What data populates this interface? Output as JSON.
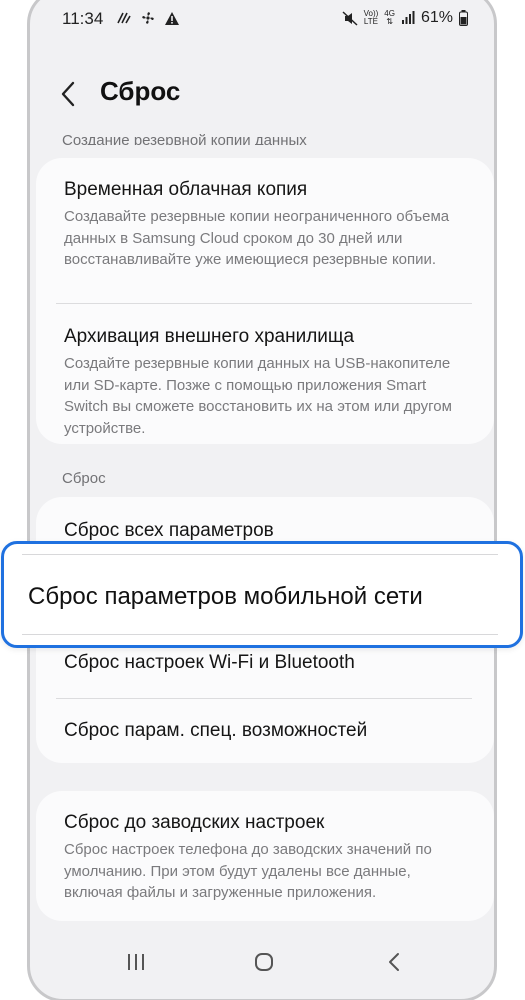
{
  "status_bar": {
    "time": "11:34",
    "volte_label": "Vo))",
    "lte_label": "LTE",
    "network_label": "4G",
    "battery": "61%"
  },
  "header": {
    "title": "Сброс"
  },
  "backup_section": {
    "label": "Создание резервной копии данных",
    "items": [
      {
        "title": "Временная облачная копия",
        "description": "Создавайте резервные копии неограниченного объема данных в Samsung Cloud сроком до 30 дней или восстанавливайте уже имеющиеся резервные копии."
      },
      {
        "title": "Архивация внешнего хранилища",
        "description": "Создайте резервные копии данных на USB-накопителе или SD-карте. Позже с помощью приложения Smart Switch вы сможете восстановить их на этом или другом устройстве."
      }
    ]
  },
  "reset_section": {
    "label": "Сброс",
    "items": [
      {
        "title": "Сброс всех параметров"
      },
      {
        "title": "Сброс параметров мобильной сети"
      },
      {
        "title": "Сброс настроек Wi-Fi и Bluetooth"
      },
      {
        "title": "Сброс парам. спец. возможностей"
      }
    ]
  },
  "factory_reset": {
    "title": "Сброс до заводских настроек",
    "description": "Сброс настроек телефона до заводских значений по умолчанию. При этом будут удалены все данные, включая файлы и загруженные приложения."
  },
  "colors": {
    "highlight": "#1f71e0",
    "background": "#f1f1f3",
    "card": "#fbfbfc"
  }
}
